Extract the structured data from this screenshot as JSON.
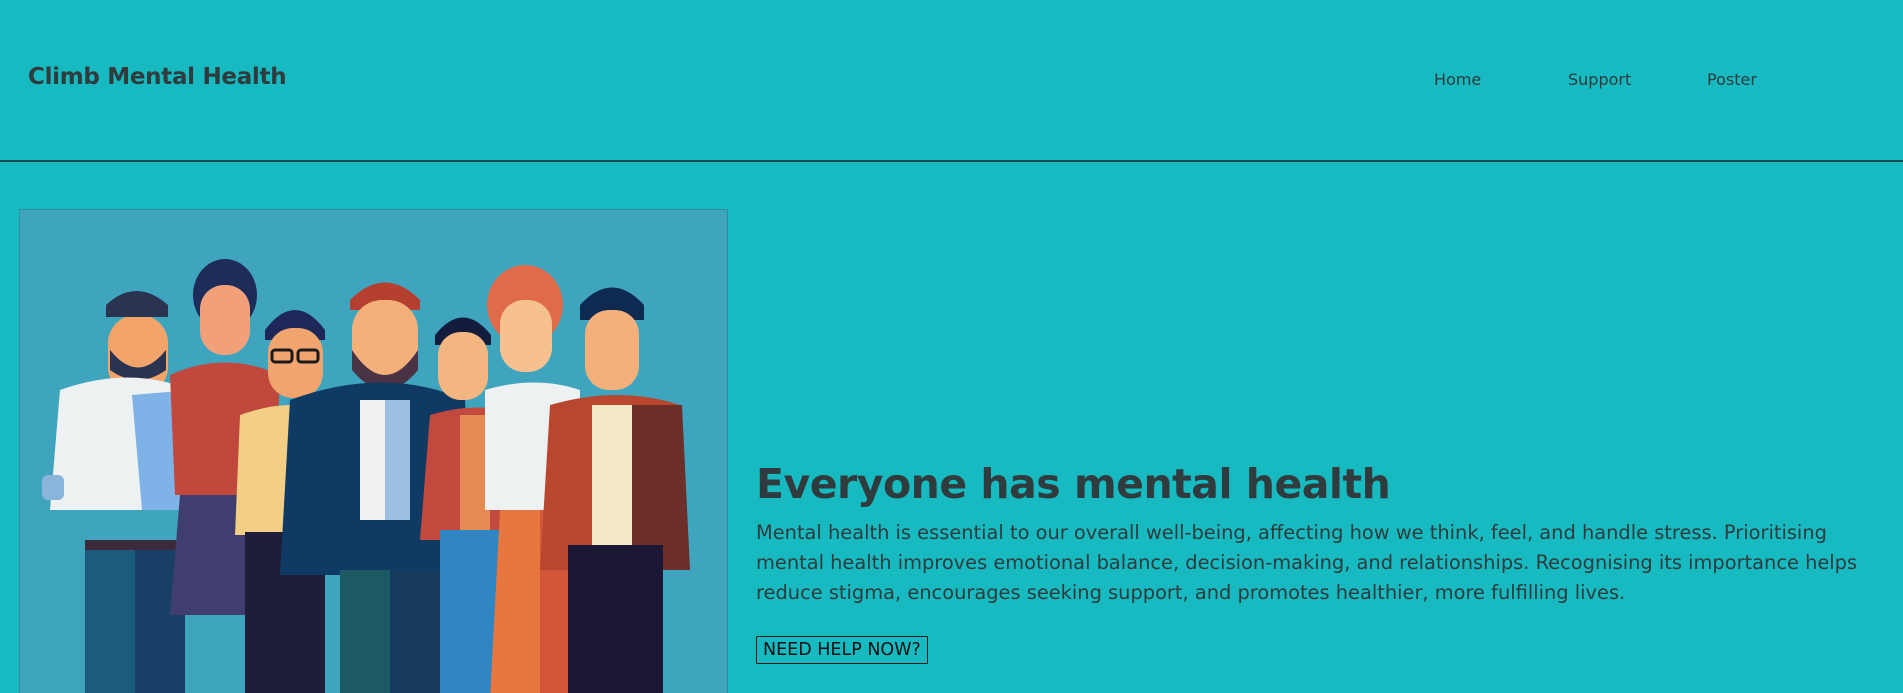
{
  "header": {
    "brand": "Climb Mental Health",
    "nav": [
      {
        "label": "Home"
      },
      {
        "label": "Support"
      },
      {
        "label": "Poster"
      }
    ]
  },
  "hero": {
    "title": "Everyone has mental health",
    "text": "Mental health is essential to our overall well-being, affecting how we think, feel, and handle stress. Prioritising mental health improves emotional balance, decision-making, and relationships. Recognising its importance helps reduce stigma, encourages seeking support, and promotes healthier, more fulfilling lives.",
    "button_label": "NEED HELP NOW?"
  },
  "colors": {
    "background": "#17bac1",
    "image_background": "#3fa5bf",
    "text": "#2f3b3c"
  },
  "illustration": {
    "name": "group-of-people-illustration"
  }
}
